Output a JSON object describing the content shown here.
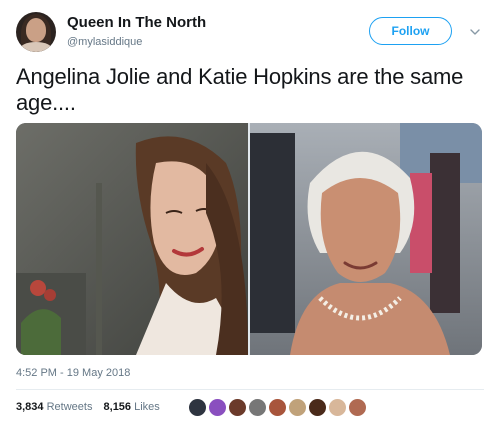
{
  "user": {
    "display_name": "Queen In The North",
    "handle": "@mylasiddique"
  },
  "actions": {
    "follow_label": "Follow",
    "more_icon": "chevron-down-icon"
  },
  "tweet": {
    "text": "Angelina Jolie and Katie Hopkins are the same age....",
    "timestamp": "4:52 PM - 19 May 2018"
  },
  "stats": {
    "retweets_count": "3,834",
    "retweets_label": "Retweets",
    "likes_count": "8,156",
    "likes_label": "Likes"
  },
  "colors": {
    "accent": "#1da1f2",
    "text": "#14171a",
    "muted": "#657786"
  }
}
